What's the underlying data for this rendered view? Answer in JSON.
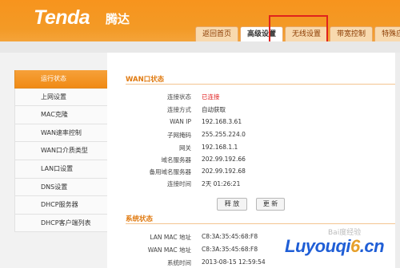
{
  "header": {
    "logo": "Tenda",
    "logo_cn": "腾达"
  },
  "tabs": [
    {
      "label": "返回首页",
      "active": false
    },
    {
      "label": "高级设置",
      "active": true
    },
    {
      "label": "无线设置",
      "active": false
    },
    {
      "label": "带宽控制",
      "active": false
    },
    {
      "label": "特殊应用",
      "active": false
    }
  ],
  "sidebar": {
    "items": [
      {
        "label": "运行状态",
        "active": true
      },
      {
        "label": "上网设置",
        "active": false
      },
      {
        "label": "MAC克隆",
        "active": false
      },
      {
        "label": "WAN速率控制",
        "active": false
      },
      {
        "label": "WAN口介质类型",
        "active": false
      },
      {
        "label": "LAN口设置",
        "active": false
      },
      {
        "label": "DNS设置",
        "active": false
      },
      {
        "label": "DHCP服务器",
        "active": false
      },
      {
        "label": "DHCP客户端列表",
        "active": false
      }
    ]
  },
  "wan": {
    "title": "WAN口状态",
    "rows": [
      {
        "label": "连接状态",
        "value": "已连接",
        "highlight": "#e02020"
      },
      {
        "label": "连接方式",
        "value": "自动获取"
      },
      {
        "label": "WAN IP",
        "value": "192.168.3.61"
      },
      {
        "label": "子网掩码",
        "value": "255.255.224.0"
      },
      {
        "label": "网关",
        "value": "192.168.1.1"
      },
      {
        "label": "域名服务器",
        "value": "202.99.192.66"
      },
      {
        "label": "备用域名服务器",
        "value": "202.99.192.68"
      },
      {
        "label": "连接时间",
        "value": "2天 01:26:21"
      }
    ],
    "release_label": "释 放",
    "renew_label": "更 新"
  },
  "system": {
    "title": "系统状态",
    "rows": [
      {
        "label": "LAN MAC 地址",
        "value": "C8:3A:35:45:68:F8"
      },
      {
        "label": "WAN MAC 地址",
        "value": "C8:3A:35:45:68:F8"
      },
      {
        "label": "系统时间",
        "value": "2013-08-15 12:59:54"
      }
    ]
  },
  "watermark": {
    "text_a": "Luyouqi",
    "text_b": "6",
    "text_c": ".cn",
    "baidu": "Bai度经验"
  },
  "colors": {
    "accent": "#f39a26",
    "annotation": "#e0231d",
    "status_connected": "#e02020"
  }
}
